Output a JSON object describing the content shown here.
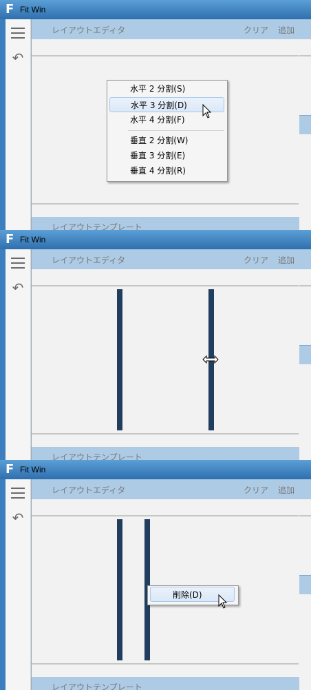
{
  "panels": [
    {
      "title": "Fit Win",
      "editor": {
        "title": "レイアウトエディタ",
        "clear": "クリア",
        "add": "追加"
      },
      "template": {
        "title": "レイアウトテンプレート"
      },
      "context_menu": {
        "items": [
          {
            "label": "水平 2 分割(S)"
          },
          {
            "label": "水平 3 分割(D)"
          },
          {
            "label": "水平 4 分割(F)"
          },
          {
            "label": "垂直 2 分割(W)"
          },
          {
            "label": "垂直 3 分割(E)"
          },
          {
            "label": "垂直 4 分割(R)"
          }
        ]
      }
    },
    {
      "title": "Fit Win",
      "editor": {
        "title": "レイアウトエディタ",
        "clear": "クリア",
        "add": "追加"
      },
      "template": {
        "title": "レイアウトテンプレート"
      }
    },
    {
      "title": "Fit Win",
      "editor": {
        "title": "レイアウトエディタ",
        "clear": "クリア",
        "add": "追加"
      },
      "template": {
        "title": "レイアウトテンプレート"
      },
      "context_menu": {
        "items": [
          {
            "label": "削除(D)"
          }
        ]
      }
    }
  ],
  "app_icon": "F",
  "icons": {
    "menu": "hamburger-icon",
    "undo": "undo-icon",
    "resize": "horizontal-resize-cursor-icon",
    "cursor": "arrow-cursor-icon"
  },
  "colors": {
    "titlebar": "#3d7fbe",
    "header": "#aecbe6",
    "divider_bar": "#213e5f",
    "background": "#f2f2f2"
  }
}
